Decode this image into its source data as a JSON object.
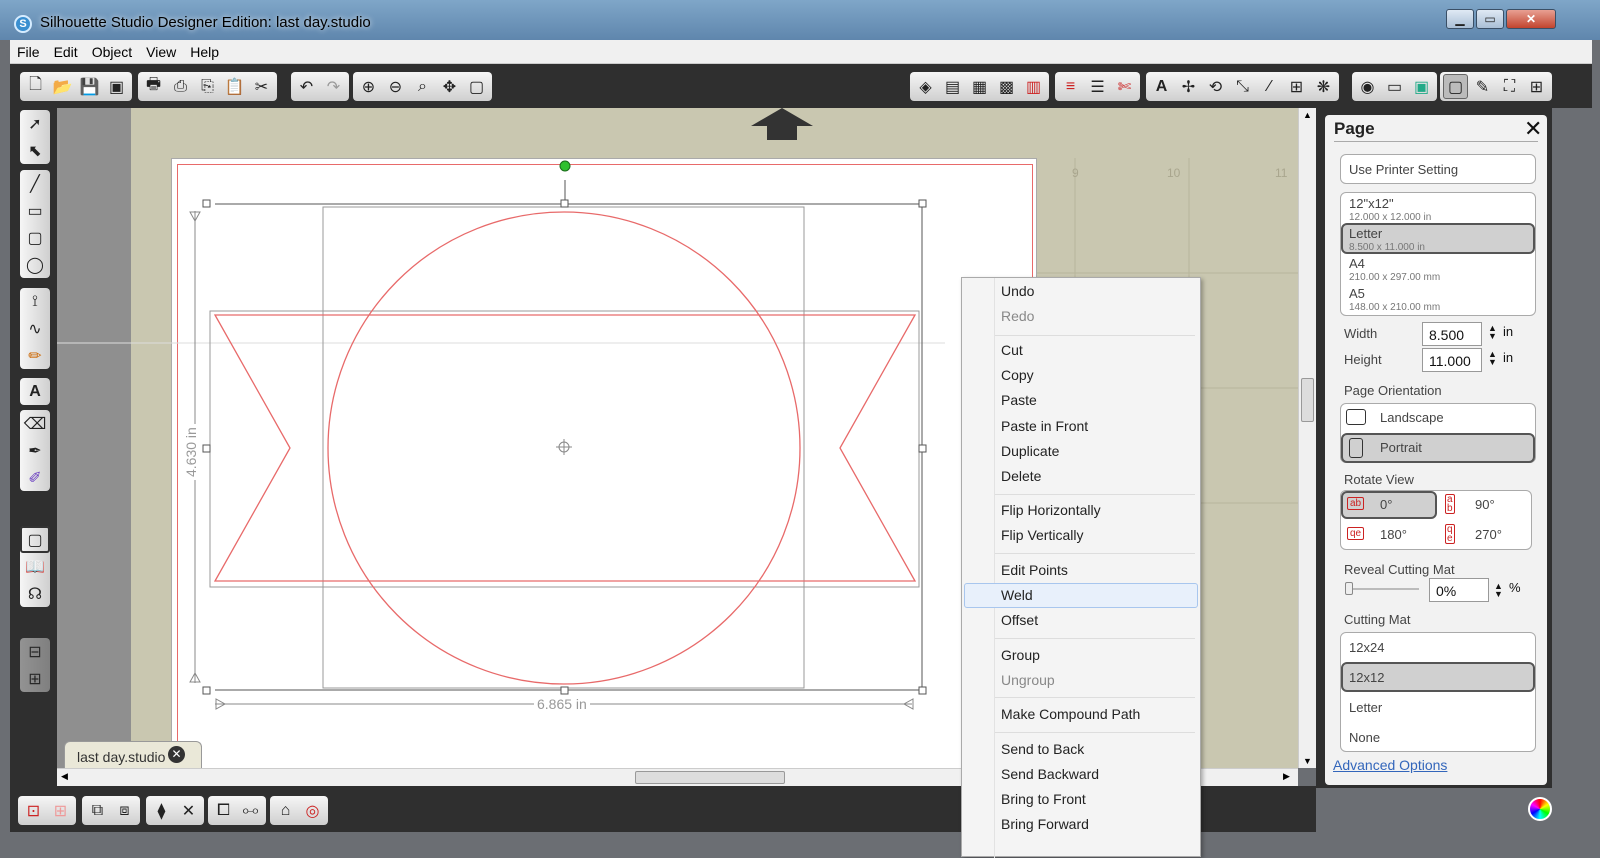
{
  "window": {
    "title": "Silhouette Studio Designer Edition: last day.studio",
    "buttons": {
      "minimize": "▁",
      "maximize": "▭",
      "close": "✕"
    }
  },
  "menubar": [
    "File",
    "Edit",
    "Object",
    "View",
    "Help"
  ],
  "document_tab": {
    "label": "last day.studio",
    "close": "✕"
  },
  "canvas": {
    "ruler_ticks": [
      "9",
      "10",
      "11"
    ],
    "height_dimension": "4.630 in",
    "width_dimension": "6.865 in"
  },
  "context_menu": {
    "items": [
      {
        "label": "Undo",
        "disabled": false
      },
      {
        "label": "Redo",
        "disabled": true
      },
      {
        "label": "Cut",
        "disabled": false
      },
      {
        "label": "Copy",
        "disabled": false
      },
      {
        "label": "Paste",
        "disabled": false
      },
      {
        "label": "Paste in Front",
        "disabled": false
      },
      {
        "label": "Duplicate",
        "disabled": false
      },
      {
        "label": "Delete",
        "disabled": false
      },
      {
        "label": "Flip Horizontally",
        "disabled": false
      },
      {
        "label": "Flip Vertically",
        "disabled": false
      },
      {
        "label": "Edit Points",
        "disabled": false
      },
      {
        "label": "Weld",
        "disabled": false,
        "highlighted": true
      },
      {
        "label": "Offset",
        "disabled": false
      },
      {
        "label": "Group",
        "disabled": false
      },
      {
        "label": "Ungroup",
        "disabled": true
      },
      {
        "label": "Make Compound Path",
        "disabled": false
      },
      {
        "label": "Send to Back",
        "disabled": false
      },
      {
        "label": "Send Backward",
        "disabled": false
      },
      {
        "label": "Bring to Front",
        "disabled": false
      },
      {
        "label": "Bring Forward",
        "disabled": false
      }
    ]
  },
  "page_panel": {
    "title": "Page",
    "close": "✕",
    "use_printer_setting": "Use Printer Setting",
    "page_sizes": [
      {
        "name": "12\"x12\"",
        "dims": "12.000 x 12.000 in"
      },
      {
        "name": "Letter",
        "dims": "8.500 x 11.000 in",
        "selected": true
      },
      {
        "name": "A4",
        "dims": "210.00 x 297.00 mm"
      },
      {
        "name": "A5",
        "dims": "148.00 x 210.00 mm"
      }
    ],
    "width_label": "Width",
    "width_value": "8.500",
    "height_label": "Height",
    "height_value": "11.000",
    "unit": "in",
    "orientation_label": "Page Orientation",
    "orientation": [
      "Landscape",
      "Portrait"
    ],
    "orientation_selected": "Portrait",
    "rotate_label": "Rotate View",
    "rotations": [
      "0°",
      "90°",
      "180°",
      "270°"
    ],
    "rotation_selected": "0°",
    "reveal_label": "Reveal Cutting Mat",
    "reveal_value": "0%",
    "reveal_unit": "%",
    "cutting_mat_label": "Cutting Mat",
    "cutting_mats": [
      "12x24",
      "12x12",
      "Letter",
      "None"
    ],
    "cutting_mat_selected": "12x12",
    "advanced": "Advanced Options"
  },
  "colors": {
    "cut_line": "#e86a6a",
    "mat": "#c9c7b0",
    "toolbar_bg": "#2f2f2f",
    "menu_highlight": "#e8f0fb"
  }
}
